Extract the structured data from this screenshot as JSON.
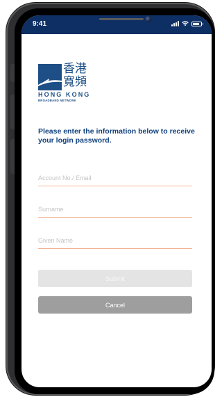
{
  "status_bar": {
    "time": "9:41",
    "background_color": "#0d2f63",
    "icons": [
      "signal-icon",
      "wifi-icon",
      "battery-icon"
    ],
    "battery_level": 0.85
  },
  "logo": {
    "chinese_line1": "香港",
    "chinese_line2": "寬頻",
    "english": "HONG KONG",
    "subtitle": "BROADBAND NETWORK",
    "brand_color": "#1d4f86"
  },
  "instruction": "Please enter the information below to receive your login password.",
  "form": {
    "account_placeholder": "Account No./ Email",
    "account_value": "",
    "surname_placeholder": "Surname",
    "surname_value": "",
    "given_name_placeholder": "Given Name",
    "given_name_value": "",
    "underline_color": "#f2b394"
  },
  "buttons": {
    "submit_label": "Submit",
    "cancel_label": "Cancel"
  }
}
